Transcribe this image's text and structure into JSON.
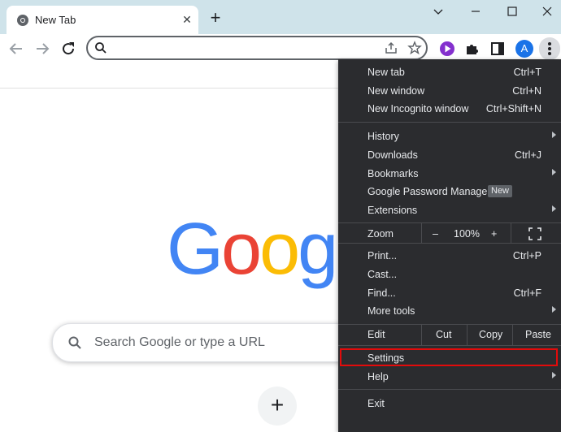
{
  "tab": {
    "title": "New Tab",
    "close": "✕"
  },
  "newtab": "+",
  "search": {
    "placeholder": "Search Google or type a URL"
  },
  "profile": {
    "initial": "A"
  },
  "logo": "Goog",
  "shortcut": "+",
  "menu": {
    "items1": [
      {
        "label": "New tab",
        "shortcut": "Ctrl+T"
      },
      {
        "label": "New window",
        "shortcut": "Ctrl+N"
      },
      {
        "label": "New Incognito window",
        "shortcut": "Ctrl+Shift+N"
      }
    ],
    "items2": [
      {
        "label": "History"
      },
      {
        "label": "Downloads",
        "shortcut": "Ctrl+J"
      },
      {
        "label": "Bookmarks"
      },
      {
        "label": "Google Password Manager",
        "badge": "New"
      },
      {
        "label": "Extensions"
      }
    ],
    "zoom": {
      "label": "Zoom",
      "minus": "–",
      "value": "100%",
      "plus": "+"
    },
    "items3": [
      {
        "label": "Print...",
        "shortcut": "Ctrl+P"
      },
      {
        "label": "Cast..."
      },
      {
        "label": "Find...",
        "shortcut": "Ctrl+F"
      },
      {
        "label": "More tools"
      }
    ],
    "edit": {
      "label": "Edit",
      "cut": "Cut",
      "copy": "Copy",
      "paste": "Paste"
    },
    "settings": "Settings",
    "help": "Help",
    "exit": "Exit"
  },
  "colors": {
    "highlight": "#e30b0b",
    "menu_bg": "#2b2c2f",
    "titlebar": "#cfe3ea"
  }
}
